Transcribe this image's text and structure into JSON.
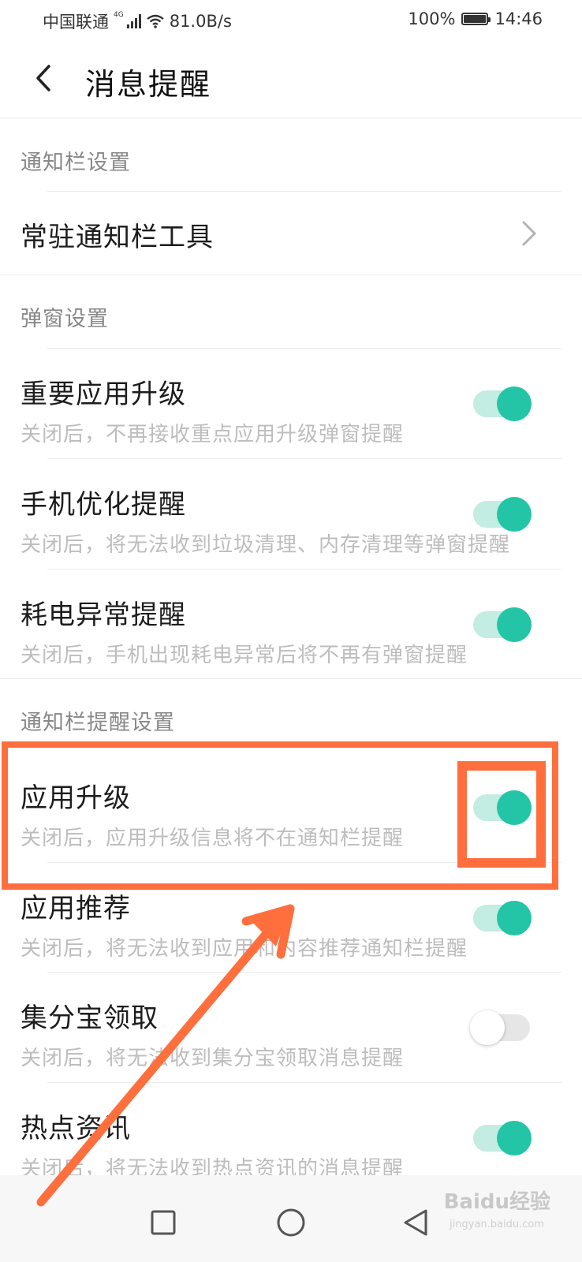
{
  "status_bar": {
    "carrier": "中国联通",
    "network_type": "4G",
    "speed": "81.0B/s",
    "battery": "100%",
    "time": "14:46"
  },
  "header": {
    "title": "消息提醒",
    "back_icon": "back-chevron-icon"
  },
  "sections": {
    "notification_bar": {
      "title": "通知栏设置",
      "items": [
        {
          "title": "常驻通知栏工具",
          "icon": "chevron-right-icon"
        }
      ]
    },
    "popup": {
      "title": "弹窗设置",
      "items": [
        {
          "title": "重要应用升级",
          "subtitle": "关闭后，不再接收重点应用升级弹窗提醒",
          "enabled": true
        },
        {
          "title": "手机优化提醒",
          "subtitle": "关闭后，将无法收到垃圾清理、内存清理等弹窗提醒",
          "enabled": true
        },
        {
          "title": "耗电异常提醒",
          "subtitle": "关闭后，手机出现耗电异常后将不再有弹窗提醒",
          "enabled": true
        }
      ]
    },
    "notification_reminder": {
      "title": "通知栏提醒设置",
      "items": [
        {
          "title": "应用升级",
          "subtitle": "关闭后，应用升级信息将不在通知栏提醒",
          "enabled": true
        },
        {
          "title": "应用推荐",
          "subtitle": "关闭后，将无法收到应用和内容推荐通知栏提醒",
          "enabled": true
        },
        {
          "title": "集分宝领取",
          "subtitle": "关闭后，将无法收到集分宝领取消息提醒",
          "enabled": false
        },
        {
          "title": "热点资讯",
          "subtitle": "关闭后，将无法收到热点资讯的消息提醒",
          "enabled": true
        }
      ]
    }
  },
  "annotation": {
    "highlight_color": "#ff6f3d"
  },
  "colors": {
    "toggle_on_knob": "#24c5a7",
    "toggle_on_track": "#c3ece2",
    "toggle_off_track": "#e6e6e6"
  },
  "navbar": {
    "buttons": [
      "square-recents-icon",
      "circle-home-icon",
      "triangle-back-icon"
    ]
  },
  "watermark": {
    "text": "Baidu经验",
    "sub": "jingyan.baidu.com"
  }
}
